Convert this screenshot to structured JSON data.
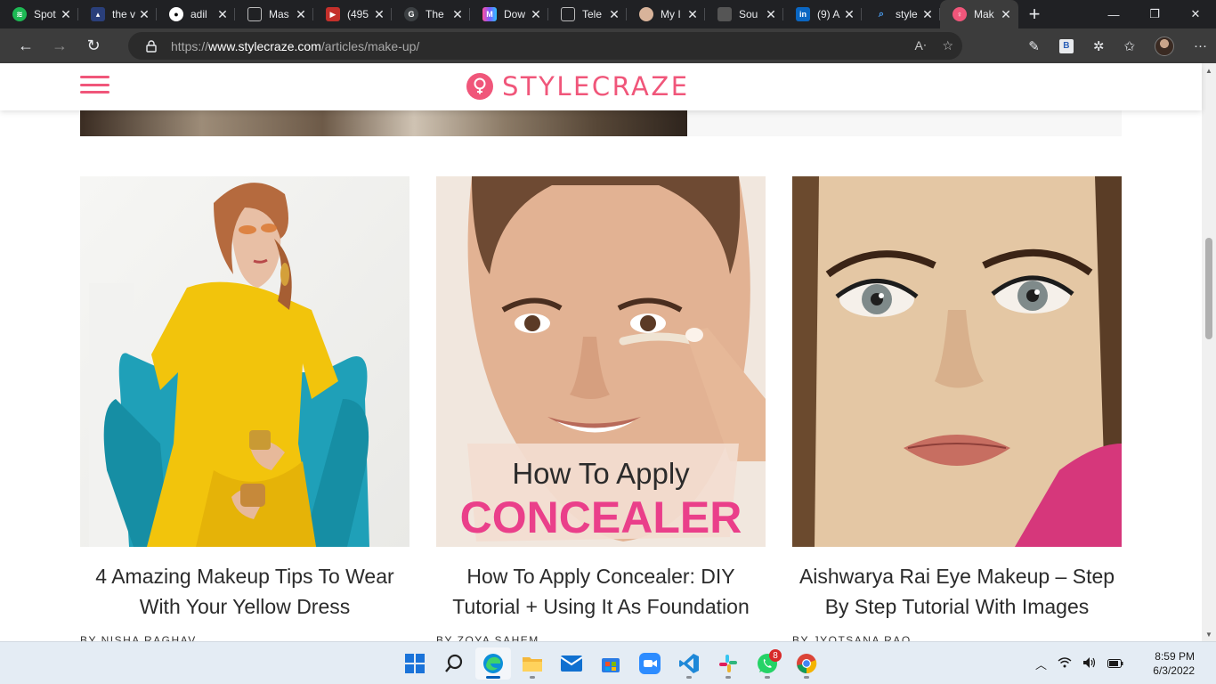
{
  "browser": {
    "tabs": [
      {
        "title": "Spot",
        "icon": "spotify-icon",
        "color": "#1db954"
      },
      {
        "title": "the v",
        "icon": "site-icon",
        "color": "#3a5fa8"
      },
      {
        "title": "adil",
        "icon": "github-icon",
        "color": "#ffffff"
      },
      {
        "title": "Mas",
        "icon": "page-icon",
        "color": "#aaaaaa"
      },
      {
        "title": "(495",
        "icon": "youtube-icon",
        "color": "#c4302b"
      },
      {
        "title": "The",
        "icon": "g-icon",
        "color": "#5f6368"
      },
      {
        "title": "Dow",
        "icon": "m-icon",
        "color": "#7b5cff"
      },
      {
        "title": "Tele",
        "icon": "page-icon",
        "color": "#aaaaaa"
      },
      {
        "title": "My I",
        "icon": "avatar-icon",
        "color": "#d8b39a"
      },
      {
        "title": "Sou",
        "icon": "profile-icon",
        "color": "#555555"
      },
      {
        "title": "(9) A",
        "icon": "linkedin-icon",
        "color": "#0a66c2"
      },
      {
        "title": "style",
        "icon": "search-icon",
        "color": "#4a9df0"
      },
      {
        "title": "Mak",
        "icon": "stylecraze-icon",
        "color": "#f0567a",
        "active": true
      }
    ],
    "url_prefix": "https://",
    "url_host": "www.stylecraze.com",
    "url_path": "/articles/make-up/",
    "extension_label": "B"
  },
  "site": {
    "logo_text": "STYLECRAZE",
    "brand_color": "#f0567a"
  },
  "articles": [
    {
      "title": "4 Amazing Makeup Tips To Wear With Your Yellow Dress",
      "byline": "BY NISHA RAGHAV"
    },
    {
      "title": "How To Apply Concealer: DIY Tutorial + Using It As Foundation",
      "byline": "BY ZOYA SAHEM",
      "image_text_1": "How To Apply",
      "image_text_2": "CONCEALER"
    },
    {
      "title": "Aishwarya Rai Eye Makeup – Step By Step Tutorial With Images",
      "byline": "BY JYOTSANA RAO"
    }
  ],
  "taskbar": {
    "whatsapp_badge": "8",
    "time": "8:59 PM",
    "date": "6/3/2022"
  }
}
